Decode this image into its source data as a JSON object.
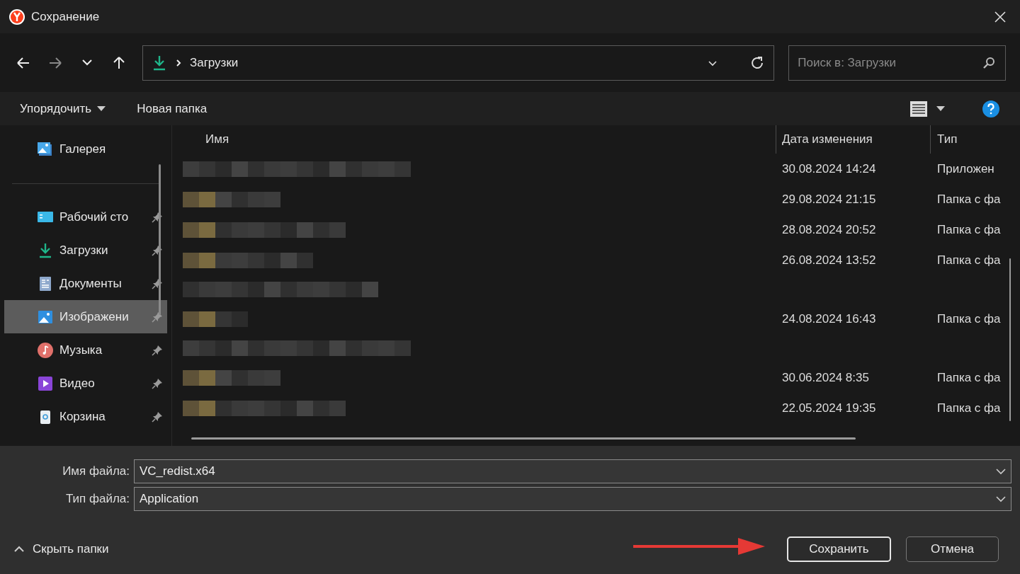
{
  "window": {
    "title": "Сохранение"
  },
  "address_bar": {
    "location": "Загрузки"
  },
  "search": {
    "placeholder": "Поиск в: Загрузки"
  },
  "toolbar": {
    "organize": "Упорядочить",
    "new_folder": "Новая папка"
  },
  "sidebar": {
    "top": [
      {
        "label": "Галерея",
        "pinned": false,
        "selected": false
      }
    ],
    "quick_access": [
      {
        "label": "Рабочий сто",
        "pinned": true,
        "selected": false
      },
      {
        "label": "Загрузки",
        "pinned": true,
        "selected": false
      },
      {
        "label": "Документы",
        "pinned": true,
        "selected": false
      },
      {
        "label": "Изображени",
        "pinned": true,
        "selected": true
      },
      {
        "label": "Музыка",
        "pinned": true,
        "selected": false
      },
      {
        "label": "Видео",
        "pinned": true,
        "selected": false
      },
      {
        "label": "Корзина",
        "pinned": true,
        "selected": false
      }
    ]
  },
  "table": {
    "columns": [
      "Имя",
      "Дата изменения",
      "Тип"
    ],
    "rows": [
      {
        "date": "30.08.2024 14:24",
        "type": "Приложен",
        "kind": "file"
      },
      {
        "date": "29.08.2024 21:15",
        "type": "Папка с фа",
        "kind": "folder"
      },
      {
        "date": "28.08.2024 20:52",
        "type": "Папка с фа",
        "kind": "folder"
      },
      {
        "date": "26.08.2024 13:52",
        "type": "Папка с фа",
        "kind": "folder"
      },
      {
        "kind": "group"
      },
      {
        "date": "24.08.2024 16:43",
        "type": "Папка с фа",
        "kind": "folder"
      },
      {
        "kind": "group"
      },
      {
        "date": "30.06.2024 8:35",
        "type": "Папка с фа",
        "kind": "folder"
      },
      {
        "date": "22.05.2024 19:35",
        "type": "Папка с фа",
        "kind": "folder"
      }
    ]
  },
  "form": {
    "filename_label": "Имя файла:",
    "filename": "VC_redist.x64",
    "filetype_label": "Тип файла:",
    "filetype": "Application"
  },
  "footer": {
    "hide_folders": "Скрыть папки",
    "save": "Сохранить",
    "cancel": "Отмена"
  }
}
